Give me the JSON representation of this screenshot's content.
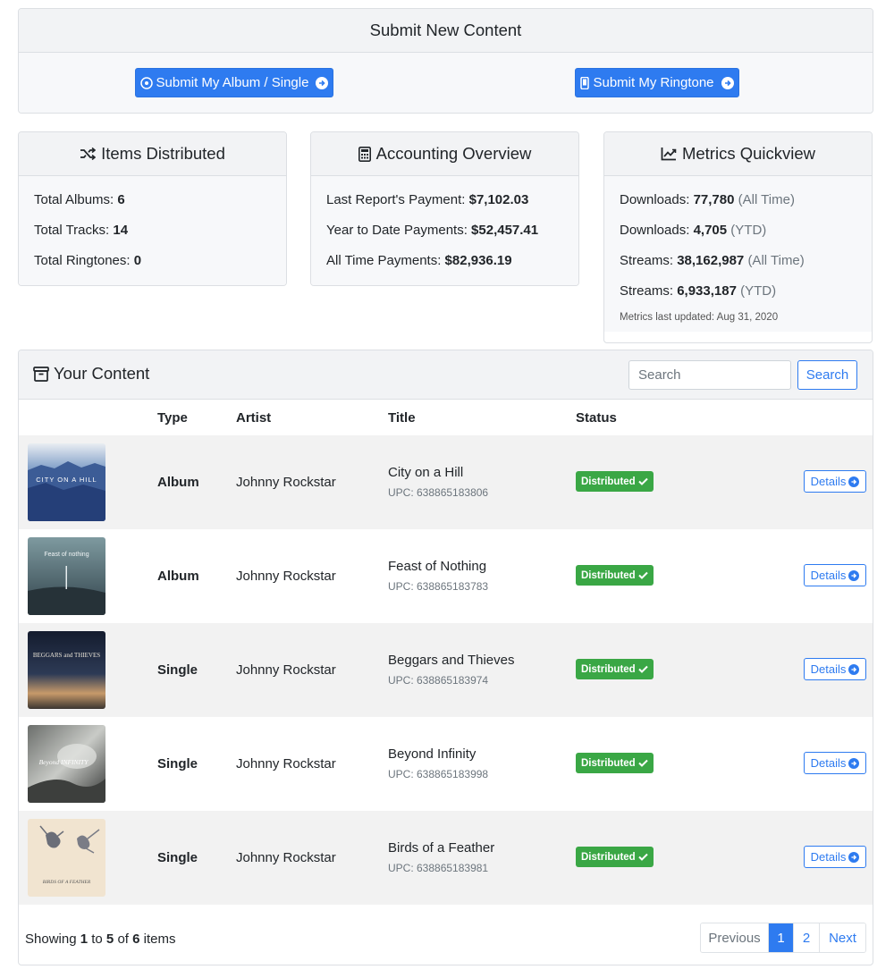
{
  "submit": {
    "title": "Submit New Content",
    "album_button": "Submit My Album / Single",
    "ringtone_button": "Submit My Ringtone"
  },
  "distributed": {
    "title": "Items Distributed",
    "albums_label": "Total Albums:",
    "albums_value": "6",
    "tracks_label": "Total Tracks:",
    "tracks_value": "14",
    "ringtones_label": "Total Ringtones:",
    "ringtones_value": "0"
  },
  "accounting": {
    "title": "Accounting Overview",
    "last_label": "Last Report's Payment:",
    "last_value": "$7,102.03",
    "ytd_label": "Year to Date Payments:",
    "ytd_value": "$52,457.41",
    "all_label": "All Time Payments:",
    "all_value": "$82,936.19"
  },
  "metrics": {
    "title": "Metrics Quickview",
    "dl_all_label": "Downloads:",
    "dl_all_value": "77,780",
    "dl_all_period": "(All Time)",
    "dl_ytd_label": "Downloads:",
    "dl_ytd_value": "4,705",
    "dl_ytd_period": "(YTD)",
    "st_all_label": "Streams:",
    "st_all_value": "38,162,987",
    "st_all_period": "(All Time)",
    "st_ytd_label": "Streams:",
    "st_ytd_value": "6,933,187",
    "st_ytd_period": "(YTD)",
    "updated": "Metrics last updated: Aug 31, 2020"
  },
  "content": {
    "title": "Your Content",
    "search_placeholder": "Search",
    "search_button": "Search",
    "columns": [
      "Type",
      "Artist",
      "Title",
      "Status"
    ],
    "rows": [
      {
        "type": "Album",
        "artist": "Johnny Rockstar",
        "title": "City on a Hill",
        "upc": "UPC: 638865183806",
        "status": "Distributed",
        "action": "Details",
        "cover_text": "CITY ON A HILL"
      },
      {
        "type": "Album",
        "artist": "Johnny Rockstar",
        "title": "Feast of Nothing",
        "upc": "UPC: 638865183783",
        "status": "Distributed",
        "action": "Details",
        "cover_text": "Feast of nothing"
      },
      {
        "type": "Single",
        "artist": "Johnny Rockstar",
        "title": "Beggars and Thieves",
        "upc": "UPC: 638865183974",
        "status": "Distributed",
        "action": "Details",
        "cover_text": "BEGGARS and THIEVES"
      },
      {
        "type": "Single",
        "artist": "Johnny Rockstar",
        "title": "Beyond Infinity",
        "upc": "UPC: 638865183998",
        "status": "Distributed",
        "action": "Details",
        "cover_text": "Beyond INFINITY"
      },
      {
        "type": "Single",
        "artist": "Johnny Rockstar",
        "title": "Birds of a Feather",
        "upc": "UPC: 638865183981",
        "status": "Distributed",
        "action": "Details",
        "cover_text": "BIRDS OF A FEATHER"
      }
    ],
    "footer": {
      "prefix": "Showing",
      "from": "1",
      "to_word": "to",
      "to": "5",
      "of_word": "of",
      "total": "6",
      "suffix": "items"
    },
    "pagination": {
      "previous": "Previous",
      "page1": "1",
      "page2": "2",
      "next": "Next"
    }
  },
  "colors": {
    "primary": "#2e7bf0",
    "success": "#3aa745"
  }
}
